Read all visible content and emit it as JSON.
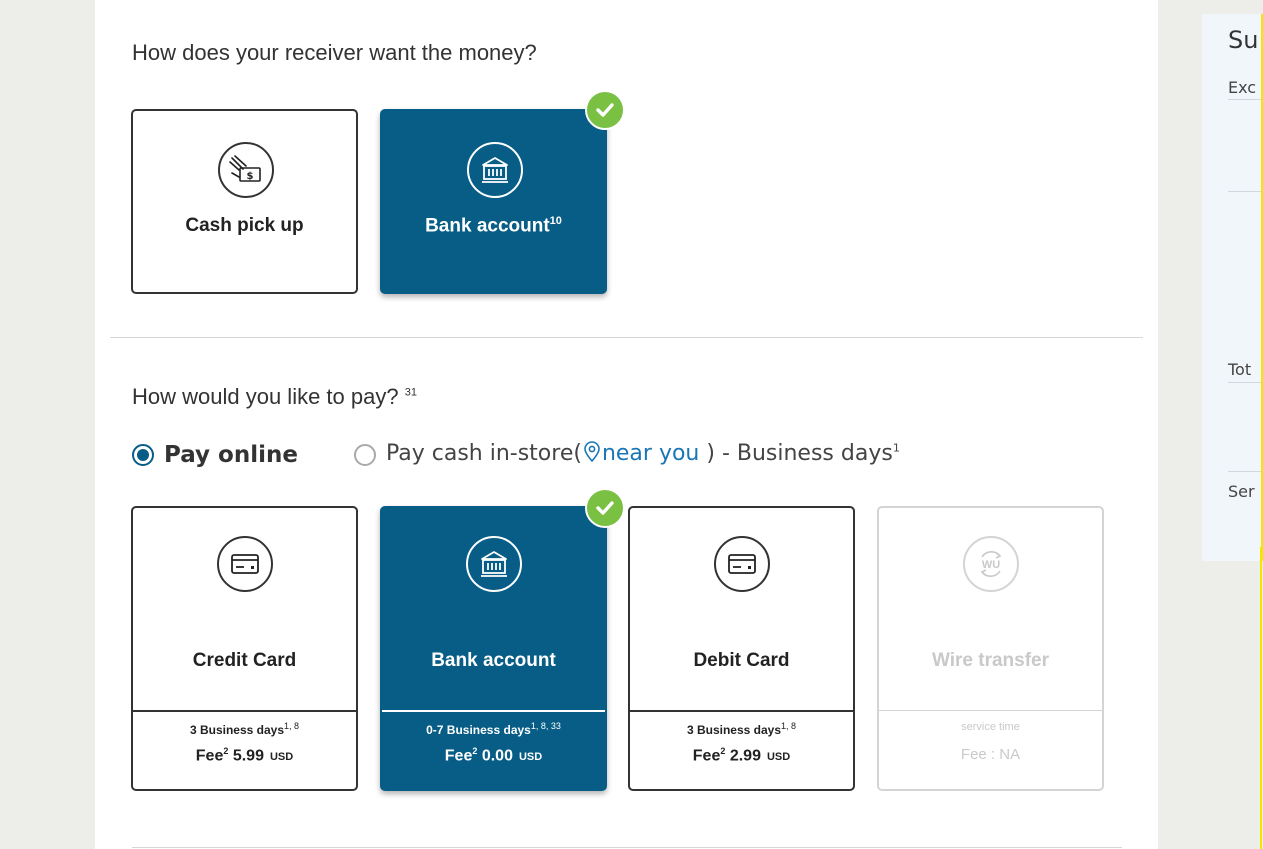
{
  "receive": {
    "heading": "How does your receiver want the money?",
    "options": [
      {
        "label": "Cash pick up",
        "sup": "",
        "icon": "cash-hand-icon",
        "selected": false
      },
      {
        "label": "Bank account",
        "sup": "10",
        "icon": "bank-icon",
        "selected": true
      }
    ]
  },
  "pay": {
    "heading": "How would you like to pay?",
    "heading_sup": "31",
    "radios": {
      "online_label": "Pay online",
      "cash_prefix": "Pay cash in-store(",
      "near_you": "near you",
      "cash_suffix": ") - Business days",
      "cash_sup": "1"
    },
    "methods": [
      {
        "label": "Credit Card",
        "days": "3 Business days",
        "days_sup": "1, 8",
        "fee_label": "Fee",
        "fee_sup": "2",
        "fee_value": "5.99",
        "currency": "USD",
        "icon": "credit-card-icon",
        "state": "normal"
      },
      {
        "label": "Bank account",
        "days": "0-7 Business days",
        "days_sup": "1, 8, 33",
        "fee_label": "Fee",
        "fee_sup": "2",
        "fee_value": "0.00",
        "currency": "USD",
        "icon": "bank-icon",
        "state": "selected"
      },
      {
        "label": "Debit Card",
        "days": "3 Business days",
        "days_sup": "1, 8",
        "fee_label": "Fee",
        "fee_sup": "2",
        "fee_value": "2.99",
        "currency": "USD",
        "icon": "debit-card-icon",
        "state": "normal"
      },
      {
        "label": "Wire transfer",
        "days": "service time",
        "fee_text": "Fee : NA",
        "icon": "wu-transfer-icon",
        "state": "disabled"
      }
    ]
  },
  "summary": {
    "title": "Su",
    "rows": [
      "Exc",
      "Tot",
      "Ser"
    ]
  },
  "colors": {
    "accent": "#075d86",
    "check": "#7ac143",
    "link": "#1b76b6"
  }
}
